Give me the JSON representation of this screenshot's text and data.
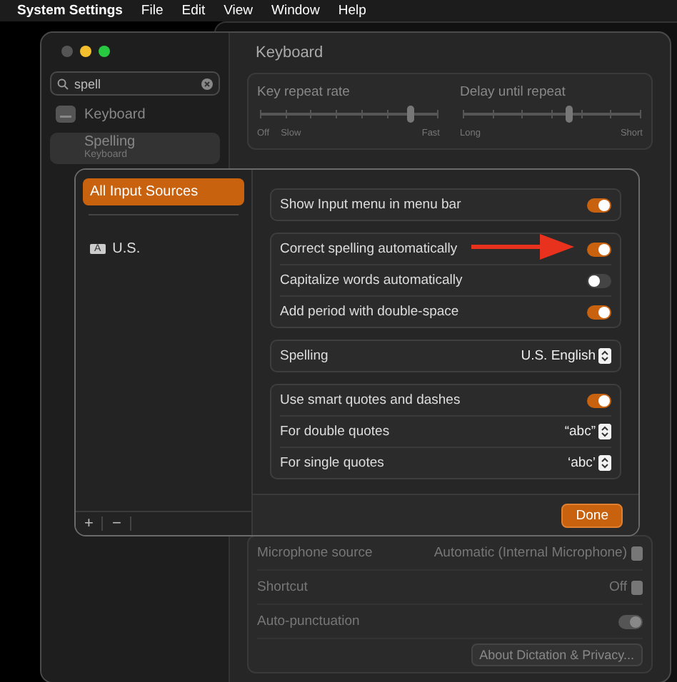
{
  "menu_bar": {
    "app": "System Settings",
    "items": [
      "File",
      "Edit",
      "View",
      "Window",
      "Help"
    ]
  },
  "sidebar": {
    "search": {
      "value": "spell"
    },
    "items": [
      {
        "label": "Keyboard",
        "selected": false
      },
      {
        "label": "Spelling",
        "subtitle": "Keyboard",
        "selected": true
      }
    ]
  },
  "content": {
    "title": "Keyboard",
    "sliders": [
      {
        "label": "Key repeat rate",
        "level": 0.85,
        "scale_labels": [
          "Off",
          "Slow",
          "Fast"
        ]
      },
      {
        "label": "Delay until repeat",
        "level": 0.6,
        "scale_labels": [
          "Long",
          "Short"
        ]
      }
    ],
    "rows": [
      {
        "kind": "select",
        "label": "Microphone source",
        "value": "Automatic (Internal Microphone)"
      },
      {
        "kind": "select",
        "label": "Shortcut",
        "value": "Off"
      },
      {
        "kind": "toggle",
        "label": "Auto-punctuation",
        "on": true
      }
    ],
    "about_button": "About Dictation & Privacy..."
  },
  "sheet": {
    "sources": [
      {
        "label": "All Input Sources",
        "selected": true
      },
      {
        "label": "U.S.",
        "badge": "A",
        "selected": false
      }
    ],
    "list_buttons": [
      "+",
      "−"
    ],
    "groups": [
      [
        {
          "kind": "toggle",
          "label": "Show Input menu in menu bar",
          "on": true
        }
      ],
      [
        {
          "kind": "toggle",
          "label": "Correct spelling automatically",
          "on": true
        },
        {
          "kind": "toggle",
          "label": "Capitalize words automatically",
          "on": false
        },
        {
          "kind": "toggle",
          "label": "Add period with double-space",
          "on": true
        }
      ],
      [
        {
          "kind": "select",
          "label": "Spelling",
          "value": "U.S. English"
        }
      ],
      [
        {
          "kind": "toggle",
          "label": "Use smart quotes and dashes",
          "on": true
        },
        {
          "kind": "select",
          "label": "For double quotes",
          "value": "“abc”"
        },
        {
          "kind": "select",
          "label": "For single quotes",
          "value": "‘abc’"
        }
      ]
    ],
    "done": "Done"
  }
}
